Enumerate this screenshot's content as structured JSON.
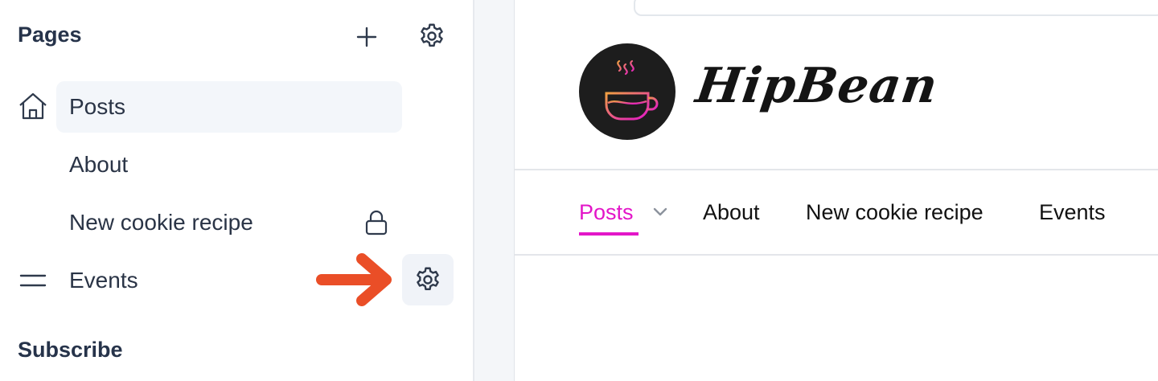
{
  "sidebar": {
    "pages_title": "Pages",
    "subscribe_title": "Subscribe",
    "pages": [
      {
        "label": "Posts",
        "active": true,
        "icon": "home-icon"
      },
      {
        "label": "About",
        "active": false
      },
      {
        "label": "New cookie recipe",
        "active": false,
        "icon": "lock-icon"
      },
      {
        "label": "Events",
        "active": false,
        "icon": "drag-handle-icon"
      }
    ],
    "actions": {
      "add_icon": "plus-icon",
      "settings_icon": "gear-icon"
    }
  },
  "preview": {
    "brand": "HipBean",
    "nav": [
      {
        "label": "Posts",
        "active": true
      },
      {
        "label": "About"
      },
      {
        "label": "New cookie recipe"
      },
      {
        "label": "Events"
      }
    ]
  },
  "colors": {
    "accent": "#e316c8",
    "arrow": "#ea4e27",
    "text": "#26334a",
    "logo_bg": "#1d1d1d"
  }
}
